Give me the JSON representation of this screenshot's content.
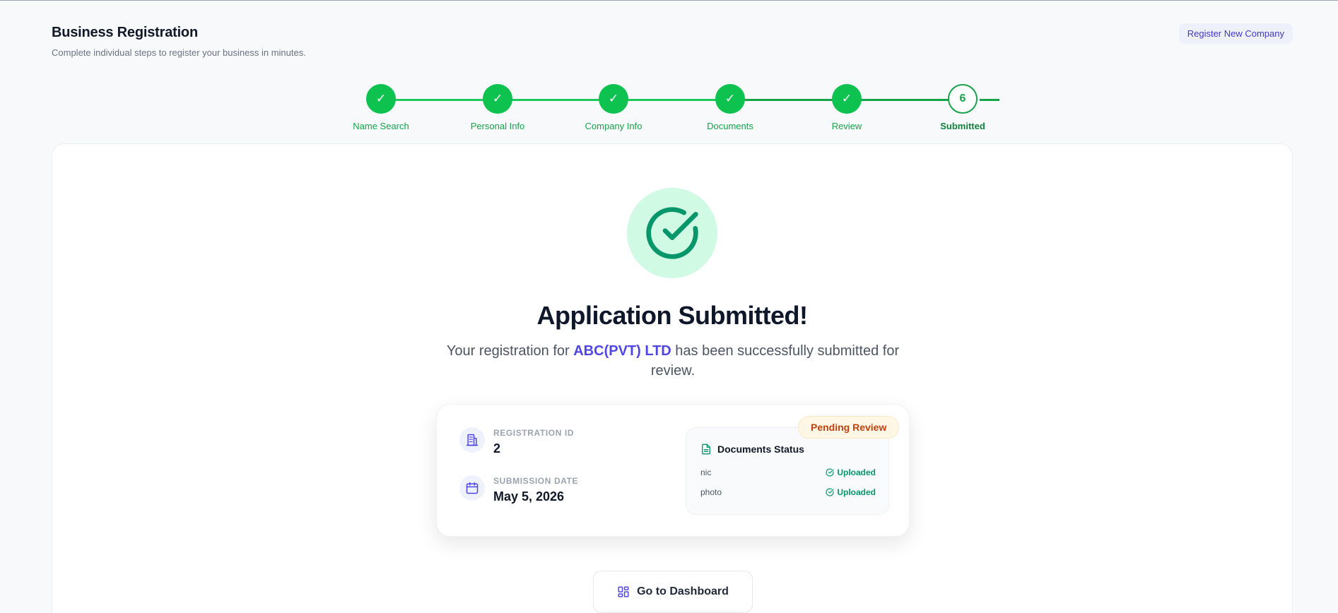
{
  "header": {
    "title": "Business Registration",
    "subtitle": "Complete individual steps to register your business in minutes.",
    "register_button": "Register New Company"
  },
  "stepper": {
    "steps": [
      {
        "label": "Name Search",
        "status": "complete",
        "mark": "✓"
      },
      {
        "label": "Personal Info",
        "status": "complete",
        "mark": "✓"
      },
      {
        "label": "Company Info",
        "status": "complete",
        "mark": "✓"
      },
      {
        "label": "Documents",
        "status": "complete",
        "mark": "✓"
      },
      {
        "label": "Review",
        "status": "complete",
        "mark": "✓"
      },
      {
        "label": "Submitted",
        "status": "current",
        "mark": "6"
      }
    ]
  },
  "success": {
    "icon": "check-circle-icon",
    "title": "Application Submitted!",
    "message_prefix": "Your registration for",
    "company_name": "ABC(PVT) LTD",
    "message_suffix": "has been successfully submitted for review."
  },
  "details": {
    "status_badge": "Pending Review",
    "registration_id_label": "REGISTRATION ID",
    "registration_id": "2",
    "submission_date_label": "SUBMISSION DATE",
    "submission_date": "May 5, 2026",
    "documents": {
      "title": "Documents Status",
      "items": [
        {
          "name": "nic",
          "status": "Uploaded"
        },
        {
          "name": "photo",
          "status": "Uploaded"
        }
      ]
    }
  },
  "actions": {
    "dashboard_button": "Go to Dashboard"
  },
  "colors": {
    "accent": "#4f46e5",
    "success": "#16a34a",
    "pending": "#c2410c"
  }
}
